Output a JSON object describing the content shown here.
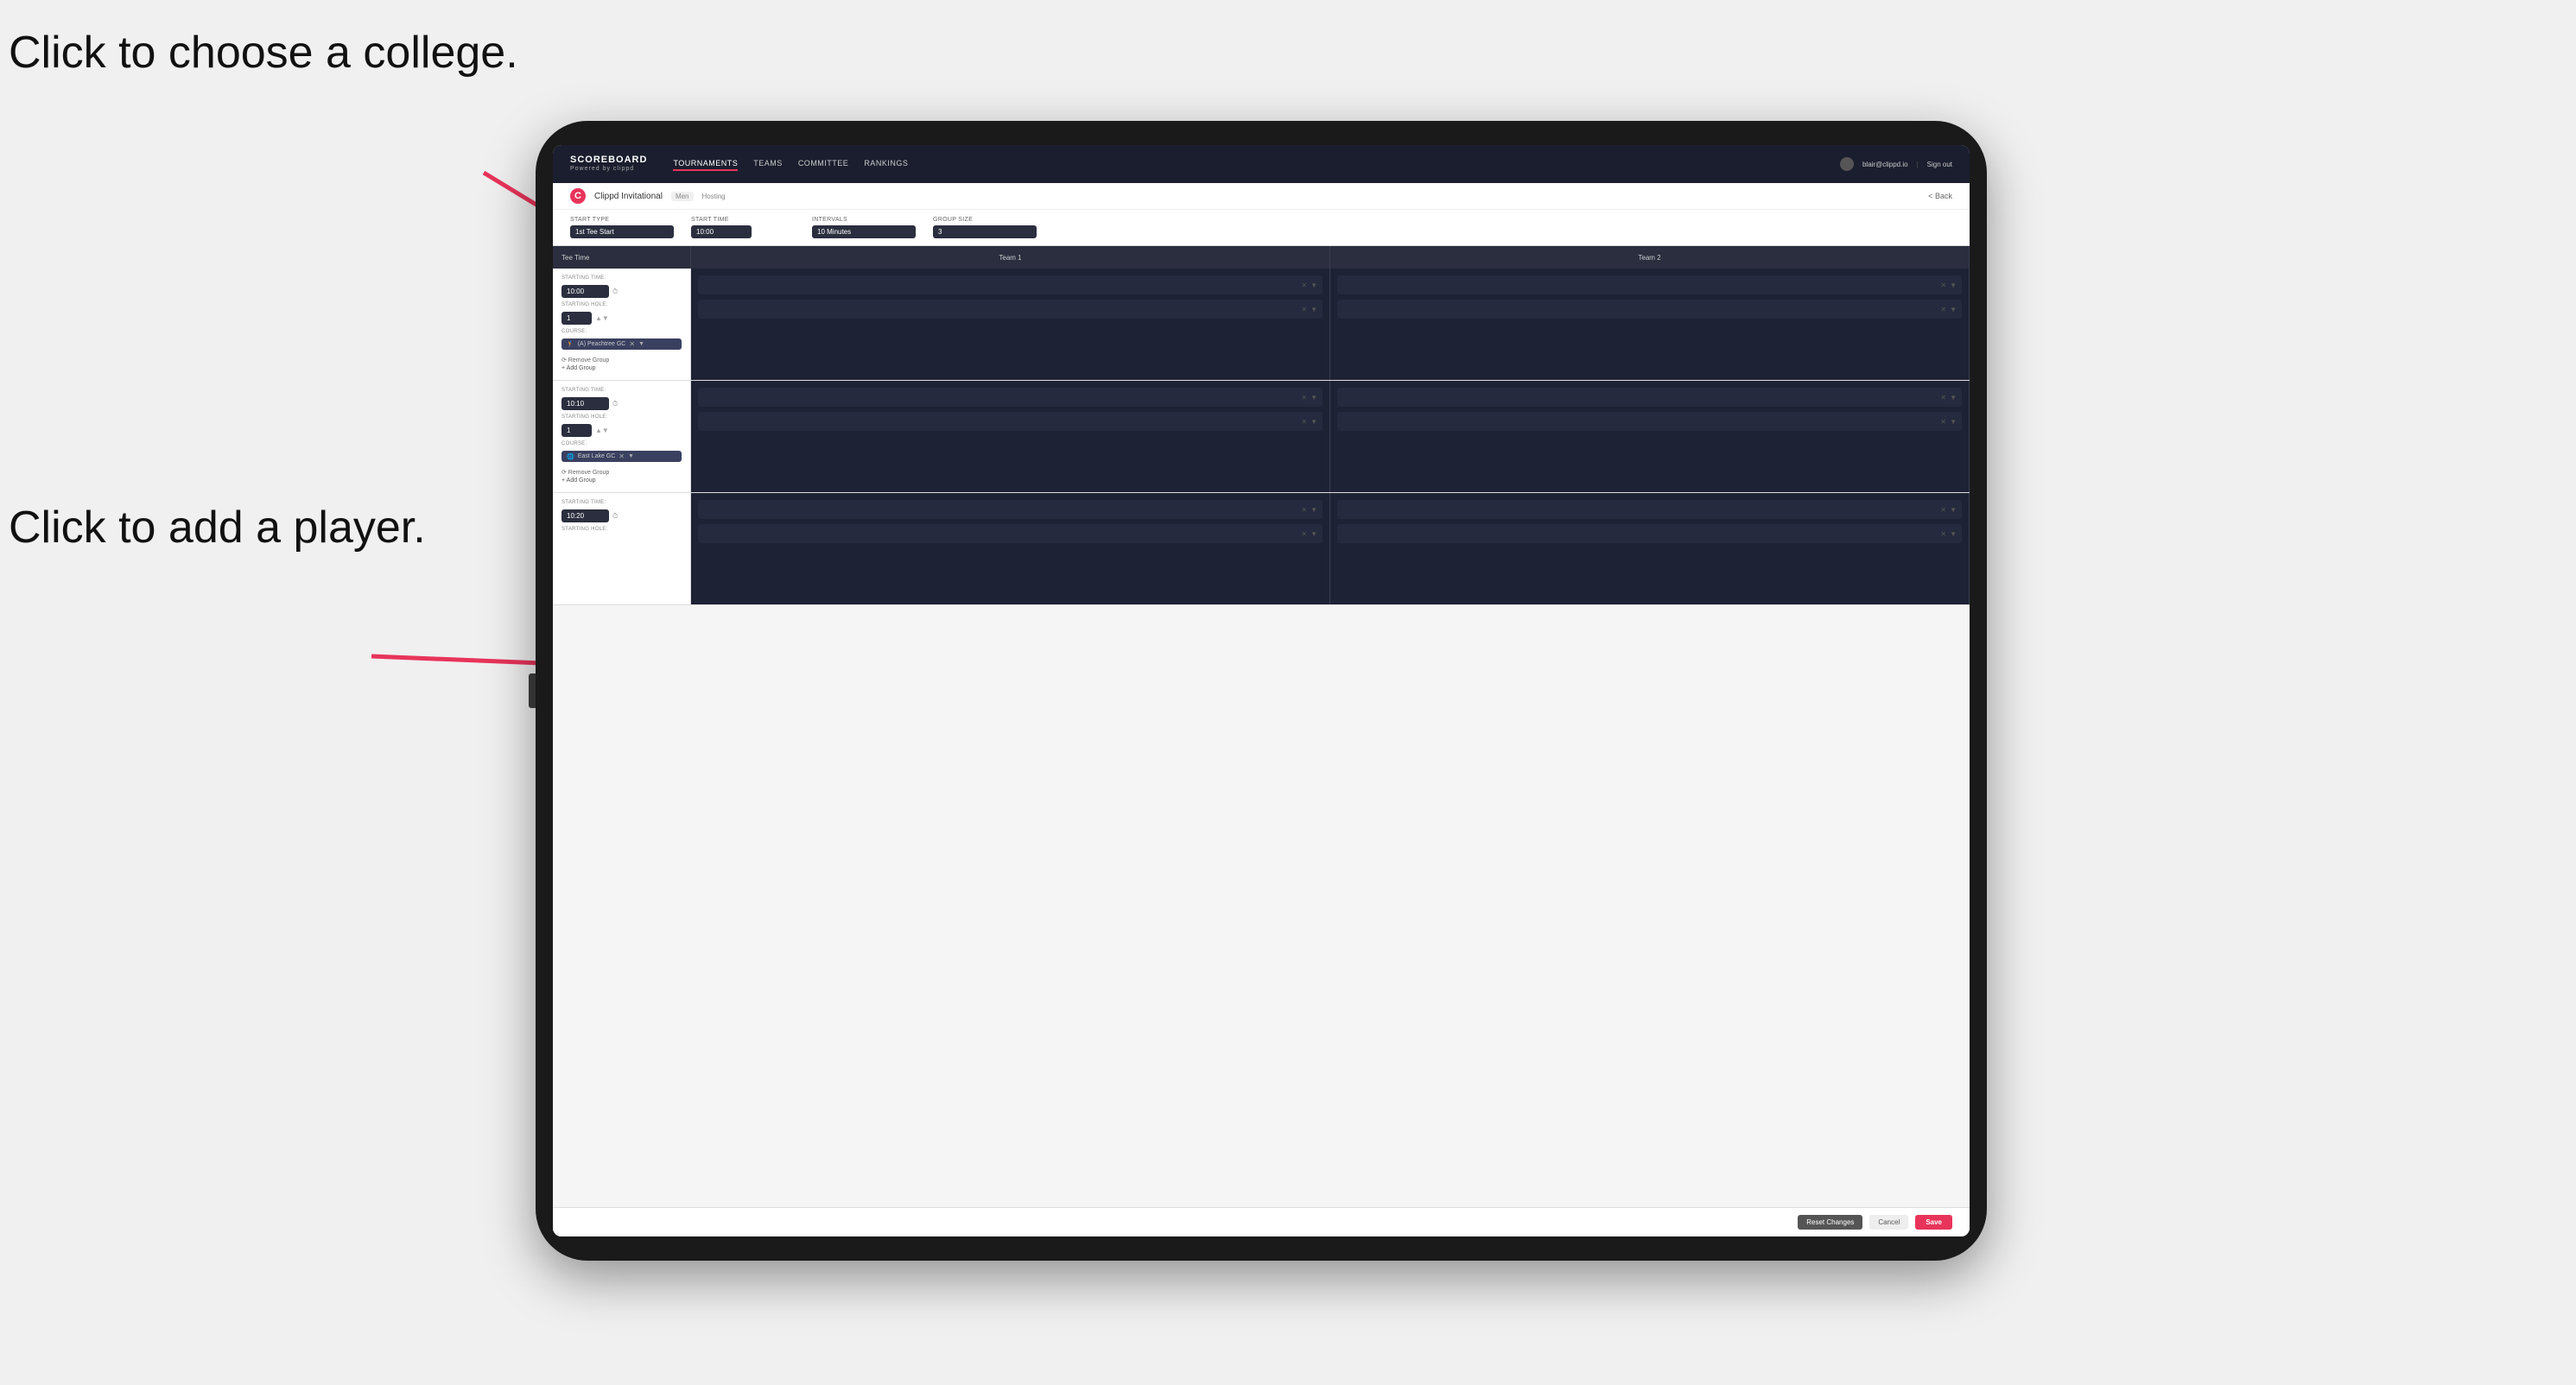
{
  "annotations": {
    "click_college": "Click to choose a\ncollege.",
    "click_player": "Click to add\na player."
  },
  "nav": {
    "logo": "SCOREBOARD",
    "logo_sub": "Powered by clippd",
    "links": [
      "TOURNAMENTS",
      "TEAMS",
      "COMMITTEE",
      "RANKINGS"
    ],
    "active_link": "TOURNAMENTS",
    "email": "blair@clippd.io",
    "sign_out": "Sign out"
  },
  "sub_header": {
    "title": "Clippd Invitational",
    "badge": "Men",
    "hosting": "Hosting",
    "back": "< Back"
  },
  "form": {
    "start_type_label": "Start Type",
    "start_type_value": "1st Tee Start",
    "start_time_label": "Start Time",
    "start_time_value": "10:00",
    "intervals_label": "Intervals",
    "intervals_value": "10 Minutes",
    "group_size_label": "Group Size",
    "group_size_value": "3"
  },
  "table": {
    "col1": "Tee Time",
    "col2": "Team 1",
    "col3": "Team 2"
  },
  "tee_rows": [
    {
      "starting_time": "10:00",
      "starting_hole": "1",
      "course": "(A) Peachtree GC",
      "has_remove": true,
      "has_add": true,
      "team1_slots": 2,
      "team2_slots": 2
    },
    {
      "starting_time": "10:10",
      "starting_hole": "1",
      "course": "East Lake GC",
      "course_icon": "globe",
      "has_remove": true,
      "has_add": true,
      "team1_slots": 2,
      "team2_slots": 2
    },
    {
      "starting_time": "10:20",
      "starting_hole": "",
      "course": "",
      "has_remove": false,
      "has_add": false,
      "team1_slots": 2,
      "team2_slots": 2
    }
  ],
  "buttons": {
    "reset": "Reset Changes",
    "cancel": "Cancel",
    "save": "Save"
  },
  "course_actions": {
    "remove": "Remove Group",
    "add": "+ Add Group"
  }
}
